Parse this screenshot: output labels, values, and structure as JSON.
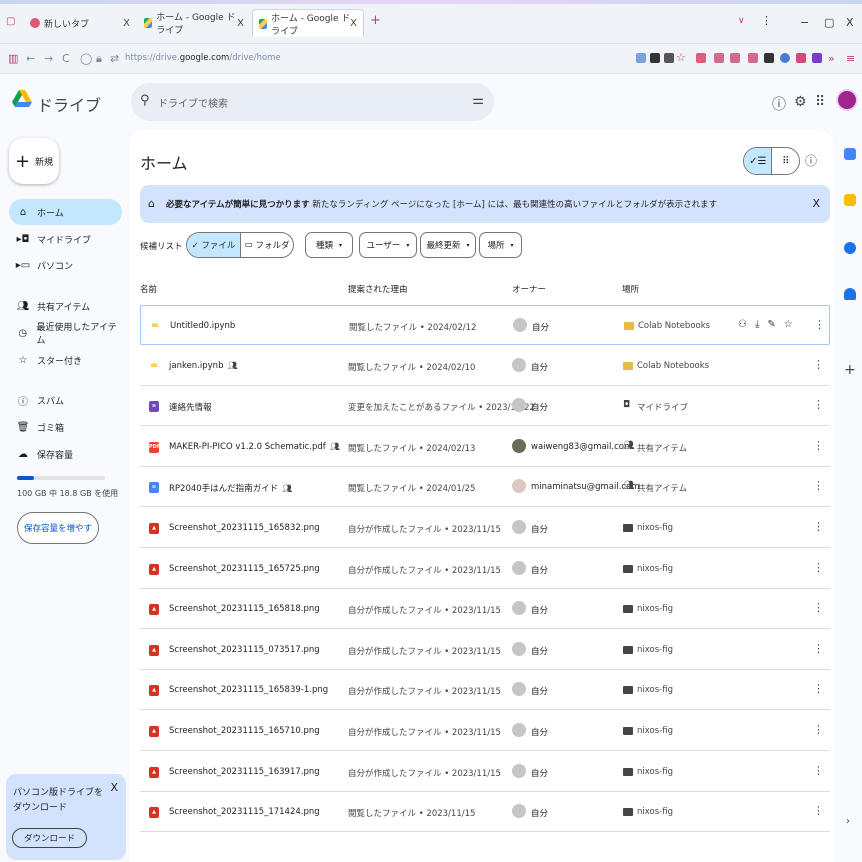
{
  "browser": {
    "tabs": [
      {
        "title": "新しいタブ",
        "close": "X"
      },
      {
        "title": "ホーム - Google ドライブ",
        "close": "X"
      },
      {
        "title": "ホーム - Google ドライブ",
        "close": "X"
      }
    ],
    "new_tab": "+",
    "url_host": "https://drive.",
    "url_domain": "google.com",
    "url_path": "/drive/home",
    "window_controls": {
      "minimize": "−",
      "maximize": "▢",
      "close": "X"
    }
  },
  "header": {
    "app_title": "ドライブ",
    "search_placeholder": "ドライブで検索"
  },
  "sidebar": {
    "new_label": "新規",
    "items": [
      {
        "label": "ホーム",
        "icon": "home-icon"
      },
      {
        "label": "マイドライブ",
        "icon": "my-drive-icon"
      },
      {
        "label": "パソコン",
        "icon": "computer-icon"
      },
      {
        "label": "共有アイテム",
        "icon": "shared-icon"
      },
      {
        "label": "最近使用したアイテム",
        "icon": "recent-icon"
      },
      {
        "label": "スター付き",
        "icon": "star-icon"
      },
      {
        "label": "スパム",
        "icon": "spam-icon"
      },
      {
        "label": "ゴミ箱",
        "icon": "trash-icon"
      },
      {
        "label": "保存容量",
        "icon": "cloud-icon"
      }
    ],
    "storage_fraction": 0.188,
    "storage_text": "100 GB 中 18.8 GB を使用",
    "buy_storage": "保存容量を増やす",
    "promo_text": "パソコン版ドライブをダウンロード",
    "promo_close": "X",
    "promo_download": "ダウンロード"
  },
  "main": {
    "title": "ホーム",
    "banner_bold": "必要なアイテムが簡単に見つかります",
    "banner_text": "新たなランディング ページになった [ホーム] には、最も関連性の高いファイルとフォルダが表示されます",
    "banner_close": "X",
    "filter_label": "候補リスト",
    "seg_files": "✓ ファイル",
    "seg_folders": "フォルダ",
    "chips": [
      "種類",
      "ユーザー",
      "最終更新",
      "場所"
    ],
    "columns": {
      "name": "名前",
      "reason": "提案された理由",
      "owner": "オーナー",
      "location": "場所"
    },
    "rows": [
      {
        "name": "Untitled0.ipynb",
        "type": "colab",
        "shared": "",
        "reason": "閲覧したファイル • 2024/02/12",
        "owner": "自分",
        "location": "Colab Notebooks",
        "loc_type": "yellow-folder"
      },
      {
        "name": "janken.ipynb",
        "type": "colab",
        "shared": "👥",
        "reason": "閲覧したファイル • 2024/02/10",
        "owner": "自分",
        "location": "Colab Notebooks",
        "loc_type": "yellow-folder"
      },
      {
        "name": "連絡先情報",
        "type": "form",
        "shared": "",
        "reason": "変更を加えたことがあるファイル • 2023/11/22",
        "owner": "自分",
        "location": "マイドライブ",
        "loc_type": "drive"
      },
      {
        "name": "MAKER-PI-PICO v1.2.0 Schematic.pdf",
        "type": "pdf",
        "shared": "👥",
        "reason": "閲覧したファイル • 2024/02/13",
        "owner": "waiweng83@gmail.com",
        "location": "共有アイテム",
        "loc_type": "shared"
      },
      {
        "name": "RP2040手はんだ指南ガイド",
        "type": "doc",
        "shared": "👥",
        "reason": "閲覧したファイル • 2024/01/25",
        "owner": "minaminatsu@gmail.com",
        "location": "共有アイテム",
        "loc_type": "shared"
      },
      {
        "name": "Screenshot_20231115_165832.png",
        "type": "image",
        "shared": "",
        "reason": "自分が作成したファイル • 2023/11/15",
        "owner": "自分",
        "location": "nixos-fig",
        "loc_type": "folder"
      },
      {
        "name": "Screenshot_20231115_165725.png",
        "type": "image",
        "shared": "",
        "reason": "自分が作成したファイル • 2023/11/15",
        "owner": "自分",
        "location": "nixos-fig",
        "loc_type": "folder"
      },
      {
        "name": "Screenshot_20231115_165818.png",
        "type": "image",
        "shared": "",
        "reason": "自分が作成したファイル • 2023/11/15",
        "owner": "自分",
        "location": "nixos-fig",
        "loc_type": "folder"
      },
      {
        "name": "Screenshot_20231115_073517.png",
        "type": "image",
        "shared": "",
        "reason": "自分が作成したファイル • 2023/11/15",
        "owner": "自分",
        "location": "nixos-fig",
        "loc_type": "folder"
      },
      {
        "name": "Screenshot_20231115_165839-1.png",
        "type": "image",
        "shared": "",
        "reason": "自分が作成したファイル • 2023/11/15",
        "owner": "自分",
        "location": "nixos-fig",
        "loc_type": "folder"
      },
      {
        "name": "Screenshot_20231115_165710.png",
        "type": "image",
        "shared": "",
        "reason": "自分が作成したファイル • 2023/11/15",
        "owner": "自分",
        "location": "nixos-fig",
        "loc_type": "folder"
      },
      {
        "name": "Screenshot_20231115_163917.png",
        "type": "image",
        "shared": "",
        "reason": "自分が作成したファイル • 2023/11/15",
        "owner": "自分",
        "location": "nixos-fig",
        "loc_type": "folder"
      },
      {
        "name": "Screenshot_20231115_171424.png",
        "type": "image",
        "shared": "",
        "reason": "閲覧したファイル • 2023/11/15",
        "owner": "自分",
        "location": "nixos-fig",
        "loc_type": "folder"
      }
    ]
  },
  "colors": {
    "accent": "#0b57d0",
    "selected": "#c2e7ff",
    "banner": "#d3e3fd"
  }
}
